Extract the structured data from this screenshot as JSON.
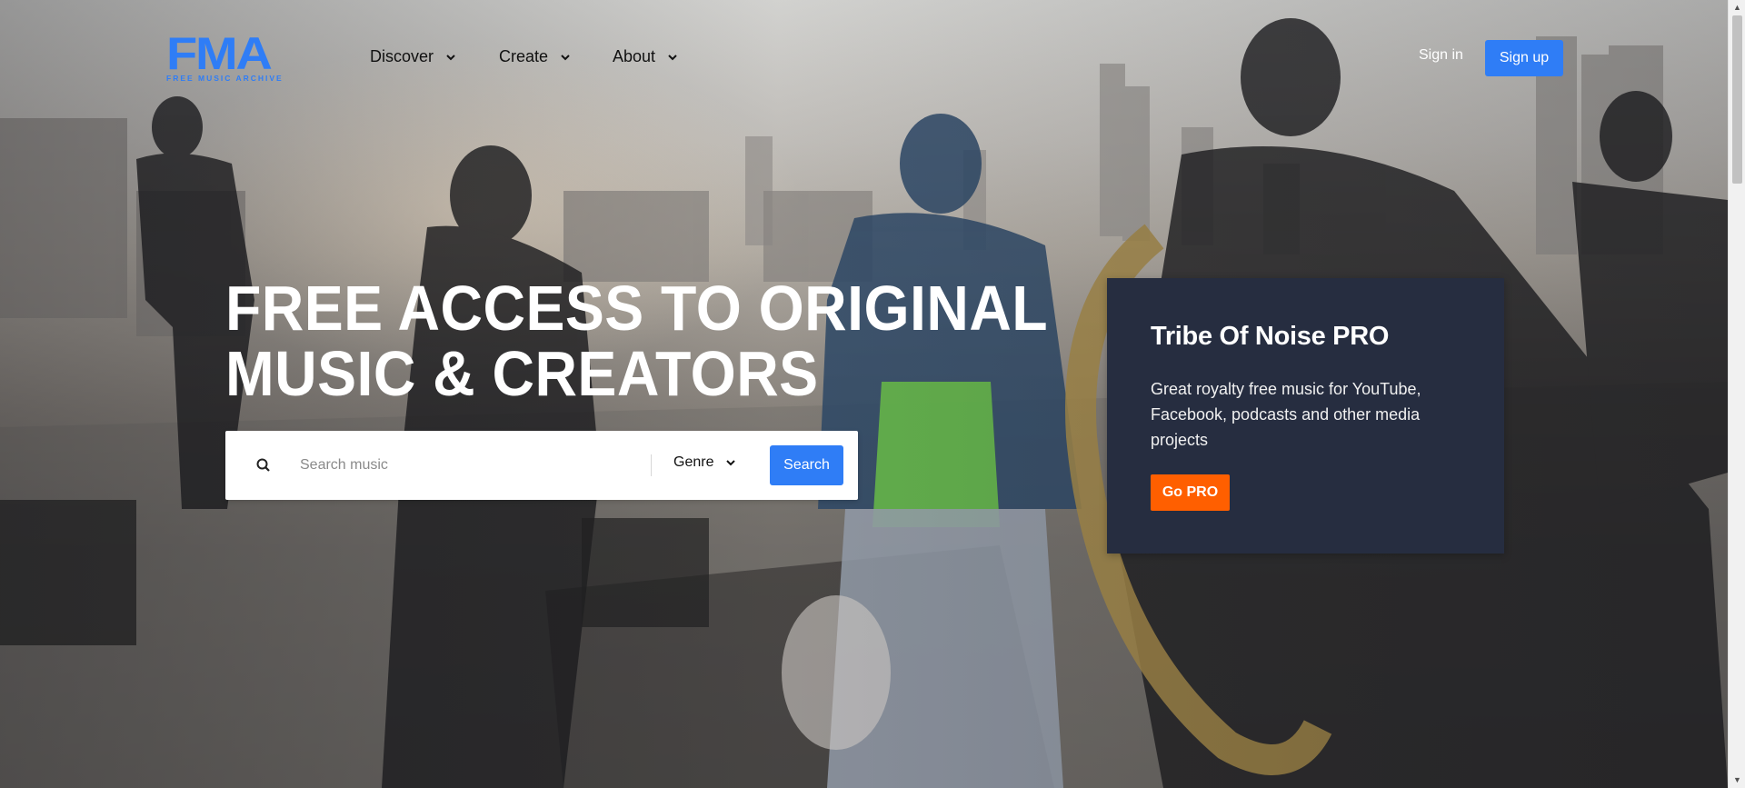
{
  "brand": {
    "logo_text": "FMA",
    "logo_subtitle": "FREE MUSIC ARCHIVE",
    "accent_color": "#2f7df6"
  },
  "nav": {
    "items": [
      {
        "label": "Discover",
        "icon": "chevron-down-icon"
      },
      {
        "label": "Create",
        "icon": "chevron-down-icon"
      },
      {
        "label": "About",
        "icon": "chevron-down-icon"
      }
    ],
    "sign_in": "Sign in",
    "sign_up": "Sign up"
  },
  "hero": {
    "headline_line1": "FREE ACCESS TO ORIGINAL",
    "headline_line2": "MUSIC & CREATORS"
  },
  "search": {
    "icon": "search-icon",
    "placeholder": "Search music",
    "value": "",
    "genre_label": "Genre",
    "button_label": "Search"
  },
  "pro_card": {
    "title": "Tribe Of Noise PRO",
    "description": "Great royalty free music for YouTube, Facebook, podcasts and other media projects",
    "button_label": "Go PRO",
    "background_color": "#262d40",
    "button_color": "#ff5f00"
  }
}
